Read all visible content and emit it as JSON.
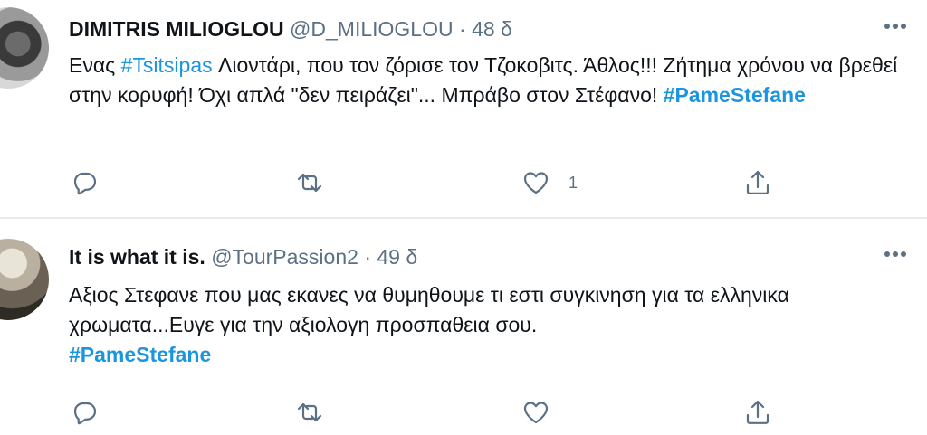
{
  "tweets": [
    {
      "author_name": "DIMITRIS MILIOGLOU",
      "handle": "@D_MILIOGLOU",
      "separator": "·",
      "time": "48 δ",
      "text": {
        "p1": "Ενας ",
        "tag1": "#Tsitsipas",
        "p2": " Λιοντάρι, που τον ζόρισε τον Τζοκοβιτς. Άθλος!!! Ζήτημα χρόνου να βρεθεί στην κορυφή! Όχι απλά \"δεν πειράζει\"... Μπράβο στον Στέφανο! ",
        "tag2": "#PameStefane"
      },
      "actions": {
        "reply_count": "",
        "retweet_count": "",
        "like_count": "1"
      },
      "avatar_icon": "profile-photo"
    },
    {
      "author_name": "It is what it is.",
      "handle": "@TourPassion2",
      "separator": "·",
      "time": "49 δ",
      "text": {
        "p1": "Αξιος Στεφανε που μας εκανες να θυμηθουμε τι εστι συγκινηση για τα ελληνικα χρωματα...Ευγε για την αξιολογη προσπαθεια σου.",
        "tag1": "#PameStefane"
      },
      "actions": {
        "reply_count": "",
        "retweet_count": "",
        "like_count": ""
      },
      "avatar_icon": "profile-photo"
    }
  ],
  "icons": {
    "more": "more-horizontal-icon",
    "reply": "reply-icon",
    "retweet": "retweet-icon",
    "like": "heart-icon",
    "share": "share-icon"
  },
  "colors": {
    "hashtag": "#1b95e0",
    "secondary_text": "#5b7083",
    "divider": "#e8ecee"
  }
}
